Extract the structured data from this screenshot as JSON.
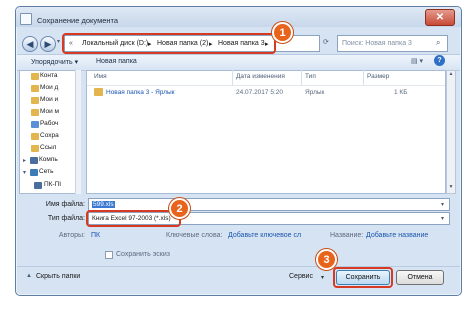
{
  "window": {
    "title": "Сохранение документа",
    "close_glyph": "✕"
  },
  "address": {
    "path": [
      "Локальный диск (D:)",
      "Новая папка (2)",
      "Новая папка 3"
    ]
  },
  "search": {
    "placeholder": "Поиск: Новая папка 3"
  },
  "toolbar": {
    "organize": "Упорядочить ▾",
    "new_folder": "Новая папка",
    "help_glyph": "?"
  },
  "sidebar": {
    "items": [
      "Конта",
      "Мои д",
      "Мои и",
      "Мои м",
      "Рабоч",
      "Сохра",
      "Ссыл",
      "Компь",
      "Сеть",
      "ПК-ПІ"
    ]
  },
  "file_list": {
    "columns": [
      "Имя",
      "Дата изменения",
      "Тип",
      "Размер"
    ],
    "rows": [
      {
        "name": "Новая папка 3 - Ярлык",
        "date": "24.07.2017 5:20",
        "type": "Ярлык",
        "size": "1 КБ"
      }
    ]
  },
  "form": {
    "filename_label": "Имя файла:",
    "filename_value": "599.xls",
    "filetype_label": "Тип файла:",
    "filetype_value": "Книга Excel 97-2003 (*.xls)",
    "authors_label": "Авторы:",
    "authors_value": "ПК",
    "keywords_label": "Ключевые слова:",
    "keywords_value": "Добавьте ключевое сл",
    "title_label": "Название:",
    "title_value": "Добавьте название",
    "thumbnail_label": "Сохранить эскиз"
  },
  "footer": {
    "hide_folders": "Скрыть папки",
    "tools": "Сервис",
    "save": "Сохранить",
    "cancel": "Отмена"
  },
  "callouts": [
    "1",
    "2",
    "3"
  ],
  "colors": {
    "accent": "#e8641c",
    "ring": "#d63a22",
    "link": "#1a56b0"
  }
}
